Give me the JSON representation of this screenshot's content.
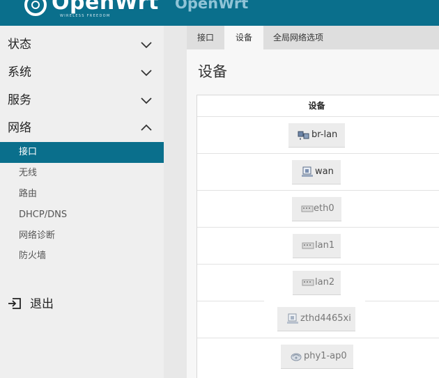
{
  "header": {
    "logo_text": "OpenWrt",
    "logo_subtitle": "WIRELESS FREEDOM",
    "hostname": "OpenWrt"
  },
  "sidebar": {
    "categories": [
      {
        "label": "状态",
        "expanded": false
      },
      {
        "label": "系统",
        "expanded": false
      },
      {
        "label": "服务",
        "expanded": false
      },
      {
        "label": "网络",
        "expanded": true
      }
    ],
    "network_items": [
      {
        "label": "接口",
        "active": true
      },
      {
        "label": "无线",
        "active": false
      },
      {
        "label": "路由",
        "active": false
      },
      {
        "label": "DHCP/DNS",
        "active": false
      },
      {
        "label": "网络诊断",
        "active": false
      },
      {
        "label": "防火墙",
        "active": false
      }
    ],
    "logout_label": "退出"
  },
  "tabs": [
    {
      "label": "接口",
      "active": false
    },
    {
      "label": "设备",
      "active": true
    },
    {
      "label": "全局网络选项",
      "active": false
    }
  ],
  "page": {
    "title": "设备"
  },
  "table": {
    "header": "设备",
    "devices": [
      {
        "name": "br-lan",
        "icon": "bridge-icon",
        "enabled": true
      },
      {
        "name": "wan",
        "icon": "ethernet-port-icon",
        "enabled": true
      },
      {
        "name": "eth0",
        "icon": "switch-icon",
        "enabled": false
      },
      {
        "name": "lan1",
        "icon": "switch-icon",
        "enabled": false
      },
      {
        "name": "lan2",
        "icon": "switch-icon",
        "enabled": false
      },
      {
        "name": "zthd4465xi",
        "icon": "ethernet-port-icon",
        "enabled": false
      },
      {
        "name": "phy1-ap0",
        "icon": "wifi-icon",
        "enabled": false
      }
    ]
  },
  "colors": {
    "brand": "#0a6f8c",
    "sidebar_bg": "#efefef",
    "active_text": "#ffffff"
  }
}
